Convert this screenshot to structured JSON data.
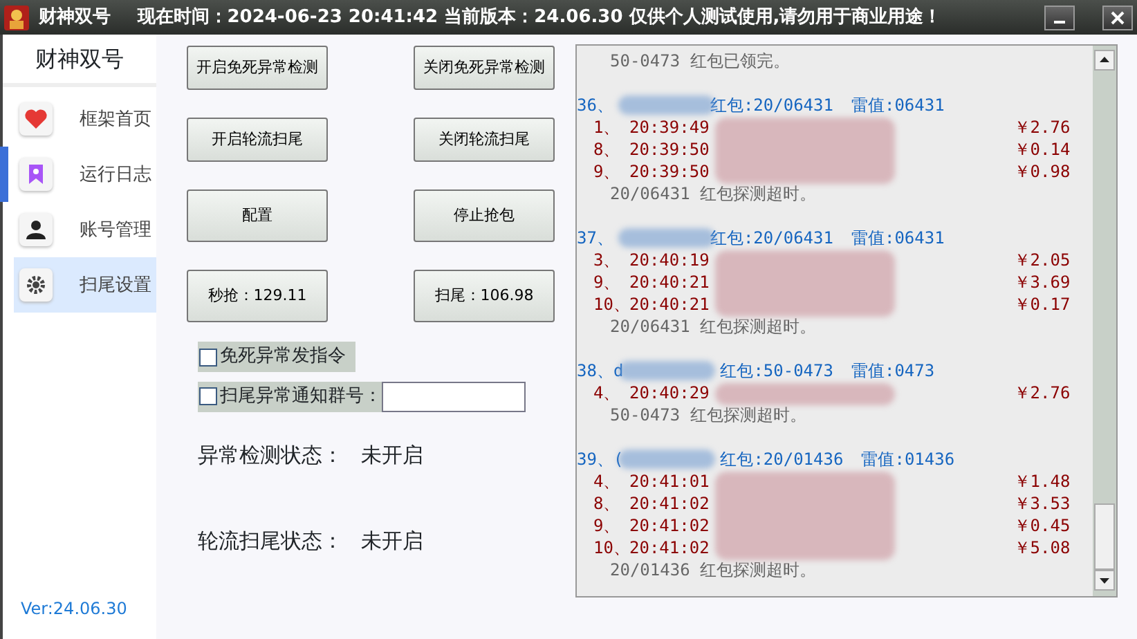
{
  "window": {
    "title": "财神双号",
    "info": "现在时间：2024-06-23 20:41:42 当前版本：24.06.30 仅供个人测试使用,请勿用于商业用途！"
  },
  "sidebar": {
    "title": "财神双号",
    "items": [
      {
        "label": "框架首页",
        "kind": "heart",
        "selected": false,
        "indicator": false
      },
      {
        "label": "运行日志",
        "kind": "bookmark",
        "selected": false,
        "indicator": true
      },
      {
        "label": "账号管理",
        "kind": "user",
        "selected": false,
        "indicator": false
      },
      {
        "label": "扫尾设置",
        "kind": "gear",
        "selected": true,
        "indicator": false
      }
    ],
    "version": "Ver:24.06.30"
  },
  "buttons": [
    {
      "label": "开启免死异常检测"
    },
    {
      "label": "关闭免死异常检测"
    },
    {
      "label": "开启轮流扫尾"
    },
    {
      "label": "关闭轮流扫尾"
    },
    {
      "label": "配置"
    },
    {
      "label": "停止抢包"
    },
    {
      "label": "秒抢：129.11"
    },
    {
      "label": "扫尾：106.98"
    }
  ],
  "options": [
    {
      "label": "免死异常发指令",
      "checked": false
    },
    {
      "label": "扫尾异常通知",
      "checked": false,
      "field_label": "群号："
    }
  ],
  "statuses": [
    {
      "label": "异常检测状态：",
      "value": "未开启"
    },
    {
      "label": "轮流扫尾状态：",
      "value": "未开启"
    }
  ],
  "log": {
    "lead": "50-0473 红包已领完。",
    "blocks": [
      {
        "number": "36、",
        "packet": "红包:20/06431",
        "mine": "雷值:06431",
        "rows": [
          {
            "index": "1、",
            "time": "20:39:49",
            "amount": "￥2.76"
          },
          {
            "index": "8、",
            "time": "20:39:50",
            "amount": "￥0.14"
          },
          {
            "index": "9、",
            "time": "20:39:50",
            "amount": "￥0.98"
          }
        ],
        "footer": "20/06431 红包探测超时。"
      },
      {
        "number": "37、",
        "packet": "红包:20/06431",
        "mine": "雷值:06431",
        "rows": [
          {
            "index": "3、",
            "time": "20:40:19",
            "amount": "￥2.05"
          },
          {
            "index": "9、",
            "time": "20:40:21",
            "amount": "￥3.69"
          },
          {
            "index": "10、",
            "time": "20:40:21",
            "amount": "￥0.17"
          }
        ],
        "footer": "20/06431 红包探测超时。"
      },
      {
        "number": "38、d",
        "packet": "红包:50-0473",
        "mine": "雷值:0473",
        "rows": [
          {
            "index": "4、",
            "time": "20:40:29",
            "amount": "￥2.76"
          }
        ],
        "footer": "50-0473 红包探测超时。"
      },
      {
        "number": "39、(",
        "packet": "红包:20/01436",
        "mine": "雷值:01436",
        "rows": [
          {
            "index": "4、",
            "time": "20:41:01",
            "amount": "￥1.48"
          },
          {
            "index": "8、",
            "time": "20:41:02",
            "amount": "￥3.53"
          },
          {
            "index": "9、",
            "time": "20:41:02",
            "amount": "￥0.45"
          },
          {
            "index": "10、",
            "time": "20:41:02",
            "amount": "￥5.08"
          }
        ],
        "footer": "20/01436 红包探测超时。"
      }
    ]
  }
}
